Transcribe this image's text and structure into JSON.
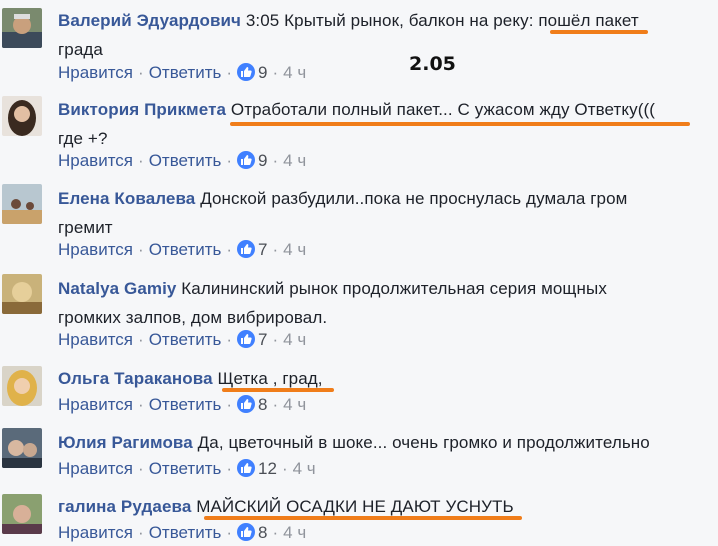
{
  "overlay_date": "2.05",
  "actions": {
    "like": "Нравится",
    "reply": "Ответить",
    "sep": "·"
  },
  "colors": {
    "link": "#385898",
    "like_badge": "#4080ff",
    "underline": "#f07d1a"
  },
  "comments": [
    {
      "author": "Валерий Эдуардович",
      "text_plain": " 3:05 Крытый рынок, балкон на реку",
      "text_mark": ": пошёл пакет",
      "text_rest": " града",
      "likes": "9",
      "time": "4 ч"
    },
    {
      "author": "Виктория Прикмета",
      "text_plain": " ",
      "text_mark": "Отработали полный пакет... С ужасом жду Ответку(((",
      "text_rest": " где +?",
      "likes": "9",
      "time": "4 ч"
    },
    {
      "author": "Елена Ковалева",
      "text_plain": " Донской разбудили..пока не проснулась думала гром гремит",
      "likes": "7",
      "time": "4 ч"
    },
    {
      "author": "Natalya Gamiy",
      "text_plain": " Калининский рынок продолжительная серия мощных громких залпов, дом вибрировал.",
      "likes": "7",
      "time": "4 ч"
    },
    {
      "author": "Ольга Тараканова",
      "text_plain": " ",
      "text_mark": "Щетка , град,",
      "likes": "8",
      "time": "4 ч"
    },
    {
      "author": "Юлия Рагимова",
      "text_plain": " Да, цветочный в шоке... очень громко и продолжительно",
      "likes": "12",
      "time": "4 ч"
    },
    {
      "author": "галина Рудаева",
      "text_plain": " ",
      "text_mark": "МАЙСКИЙ ОСАДКИ НЕ ДАЮТ УСНУТЬ",
      "likes": "8",
      "time": "4 ч"
    }
  ]
}
